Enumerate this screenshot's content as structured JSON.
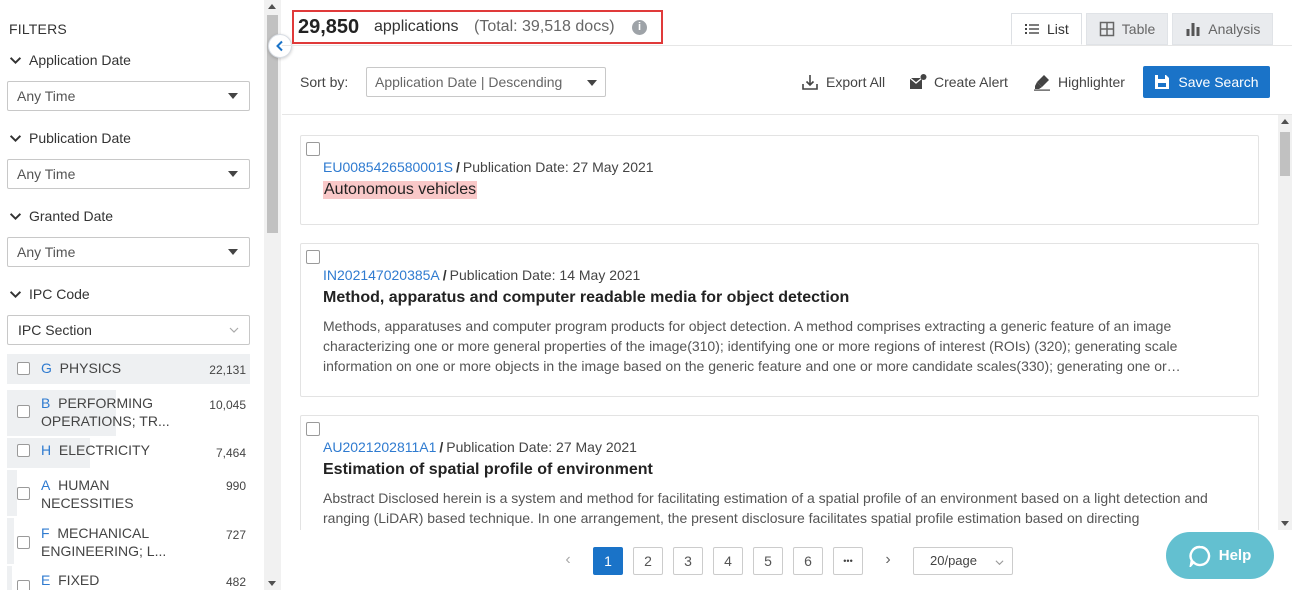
{
  "sidebar": {
    "title": "FILTERS",
    "sections": [
      {
        "label": "Application Date",
        "value": "Any Time"
      },
      {
        "label": "Publication Date",
        "value": "Any Time"
      },
      {
        "label": "Granted Date",
        "value": "Any Time"
      },
      {
        "label": "IPC Code",
        "value": "IPC Section"
      }
    ],
    "ipc_items": [
      {
        "code": "G",
        "name": "PHYSICS",
        "count": "22,131",
        "share": 1.0
      },
      {
        "code": "B",
        "name": "PERFORMING",
        "name2": "OPERATIONS; TR...",
        "count": "10,045",
        "share": 0.45
      },
      {
        "code": "H",
        "name": "ELECTRICITY",
        "count": "7,464",
        "share": 0.34
      },
      {
        "code": "A",
        "name": "HUMAN",
        "name2": "NECESSITIES",
        "count": "990",
        "share": 0.04
      },
      {
        "code": "F",
        "name": "MECHANICAL",
        "name2": "ENGINEERING; L...",
        "count": "727",
        "share": 0.03
      },
      {
        "code": "E",
        "name": "FIXED",
        "count": "482",
        "share": 0.02
      }
    ]
  },
  "header": {
    "count": "29,850",
    "count_label": "applications",
    "total": "(Total: 39,518 docs)",
    "tabs": [
      {
        "label": "List",
        "icon": "list-icon",
        "active": true
      },
      {
        "label": "Table",
        "icon": "table-icon",
        "active": false
      },
      {
        "label": "Analysis",
        "icon": "bar-chart-icon",
        "active": false
      }
    ]
  },
  "toolbar": {
    "sort_label": "Sort by:",
    "sort_value": "Application Date | Descending",
    "export_label": "Export All",
    "alert_label": "Create Alert",
    "highlighter_label": "Highlighter",
    "save_label": "Save Search"
  },
  "results": [
    {
      "id": "EU0085426580001S",
      "pub": "Publication Date: 27 May 2021",
      "title": "Autonomous vehicles",
      "highlighted": true,
      "abstract": ""
    },
    {
      "id": "IN202147020385A",
      "pub": "Publication Date: 14 May 2021",
      "title": "Method, apparatus and computer readable media for object detection",
      "highlighted": false,
      "abstract": "Methods, apparatuses and computer program products for object detection. A method comprises extracting a generic feature of an image characterizing one or more general properties of the image(310); identifying one or more regions of interest (ROIs) (320); generating scale information on one or more objects in the image based on the generic feature and one or more candidate scales(330); generating one or…"
    },
    {
      "id": "AU2021202811A1",
      "pub": "Publication Date: 27 May 2021",
      "title": "Estimation of spatial profile of environment",
      "highlighted": false,
      "abstract": "Abstract Disclosed herein is a system and method for facilitating estimation of a spatial profile of an environment based on a light detection and ranging (LiDAR) based technique. In one arrangement, the present disclosure facilitates spatial profile estimation based on directing"
    }
  ],
  "pagination": {
    "pages": [
      "1",
      "2",
      "3",
      "4",
      "5",
      "6"
    ],
    "ellipsis": "•••",
    "prev": "‹",
    "next": "›",
    "page_size": "20/page"
  },
  "help": {
    "label": "Help"
  },
  "colors": {
    "accent": "#1a73c8",
    "link": "#2f7bd0",
    "highlight": "#f9c8c8",
    "help": "#63c0d0",
    "box": "#e03a3a"
  }
}
